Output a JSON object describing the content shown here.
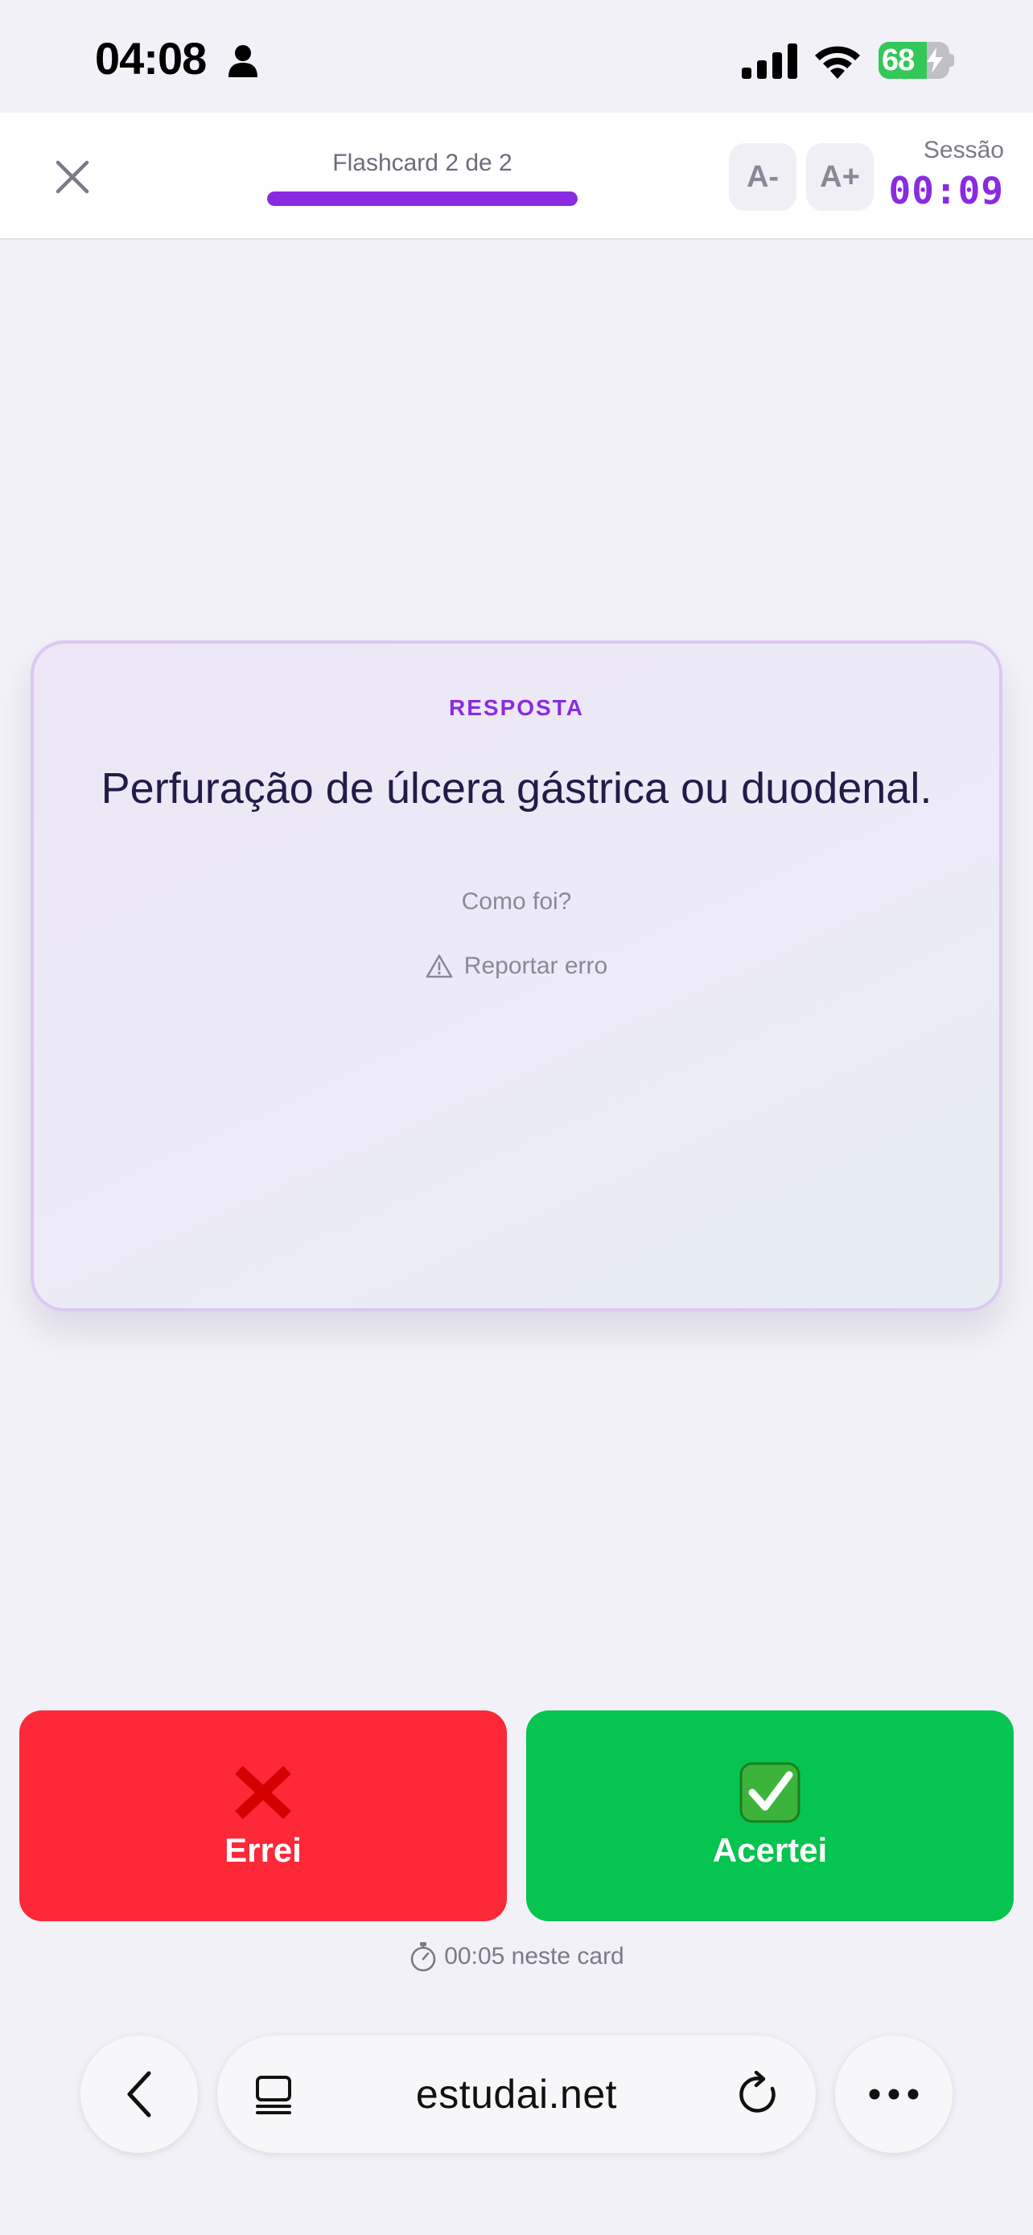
{
  "status_bar": {
    "time": "04:08",
    "battery": "68",
    "battery_level": 0.68
  },
  "header": {
    "progress_label": "Flashcard 2 de 2",
    "progress": 1.0,
    "font_decrease_label": "A-",
    "font_increase_label": "A+",
    "session_label": "Sessão",
    "session_time": "00:09"
  },
  "card": {
    "label": "RESPOSTA",
    "answer": "Perfuração de úlcera gástrica ou duodenal.",
    "question": "Como foi?",
    "report_label": "Reportar erro"
  },
  "actions": {
    "wrong_label": "Errei",
    "wrong_icon": "red-cross-icon",
    "right_label": "Acertei",
    "right_icon": "check-mark-icon"
  },
  "card_timer": "00:05 neste card",
  "browser": {
    "url": "estudai.net"
  },
  "colors": {
    "accent": "#8a2be2",
    "wrong": "#fd2838",
    "right": "#05c44f",
    "text_dark": "#231c48"
  }
}
